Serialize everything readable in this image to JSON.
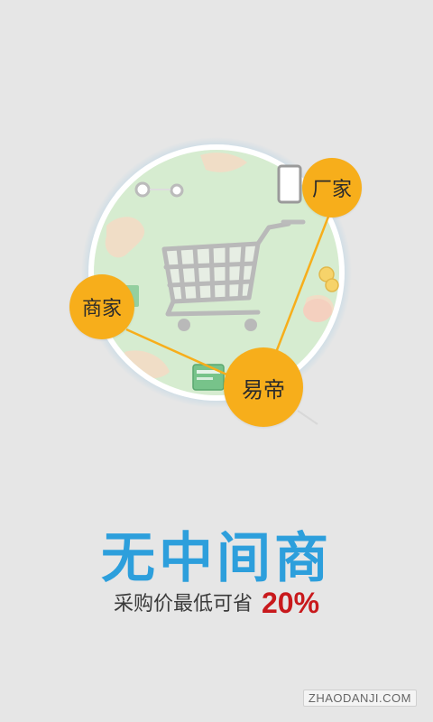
{
  "illustration": {
    "nodes": {
      "factory": "厂家",
      "merchant": "商家",
      "platform": "易帝"
    },
    "colors": {
      "globe_fill": "#d6ecd0",
      "land": "#f3dcc4",
      "bubble": "#f7ae1b",
      "connector": "#f7ae1b",
      "cart": "#b9b9b9"
    }
  },
  "headline": "无中间商",
  "subline": {
    "text": "采购价最低可省",
    "percent": "20%"
  },
  "watermark": "ZHAODANJI.COM",
  "colors": {
    "background": "#e6e6e6",
    "headline": "#2d9fdc",
    "percent": "#c8191c"
  }
}
